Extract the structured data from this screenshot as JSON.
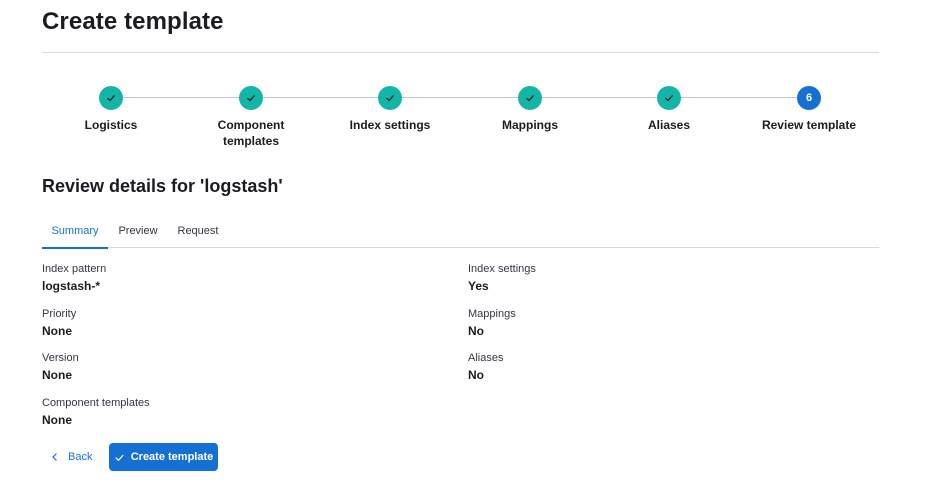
{
  "page": {
    "title": "Create template"
  },
  "steps": [
    {
      "label": "Logistics",
      "status": "complete"
    },
    {
      "label": "Component templates",
      "status": "complete"
    },
    {
      "label": "Index settings",
      "status": "complete"
    },
    {
      "label": "Mappings",
      "status": "complete"
    },
    {
      "label": "Aliases",
      "status": "complete"
    },
    {
      "label": "Review template",
      "status": "current",
      "number": "6"
    }
  ],
  "review": {
    "title": "Review details for 'logstash'"
  },
  "tabs": [
    {
      "label": "Summary",
      "selected": true
    },
    {
      "label": "Preview",
      "selected": false
    },
    {
      "label": "Request",
      "selected": false
    }
  ],
  "summary": {
    "index_pattern": {
      "label": "Index pattern",
      "value": "logstash-*"
    },
    "priority": {
      "label": "Priority",
      "value": "None"
    },
    "version": {
      "label": "Version",
      "value": "None"
    },
    "component_templates": {
      "label": "Component templates",
      "value": "None"
    },
    "index_settings": {
      "label": "Index settings",
      "value": "Yes"
    },
    "mappings": {
      "label": "Mappings",
      "value": "No"
    },
    "aliases": {
      "label": "Aliases",
      "value": "No"
    }
  },
  "actions": {
    "back_label": "Back",
    "create_label": "Create template"
  },
  "colors": {
    "primary": "#1670d4",
    "success": "#12b5a6",
    "text": "#1a1c21",
    "border": "#d3dae6"
  }
}
